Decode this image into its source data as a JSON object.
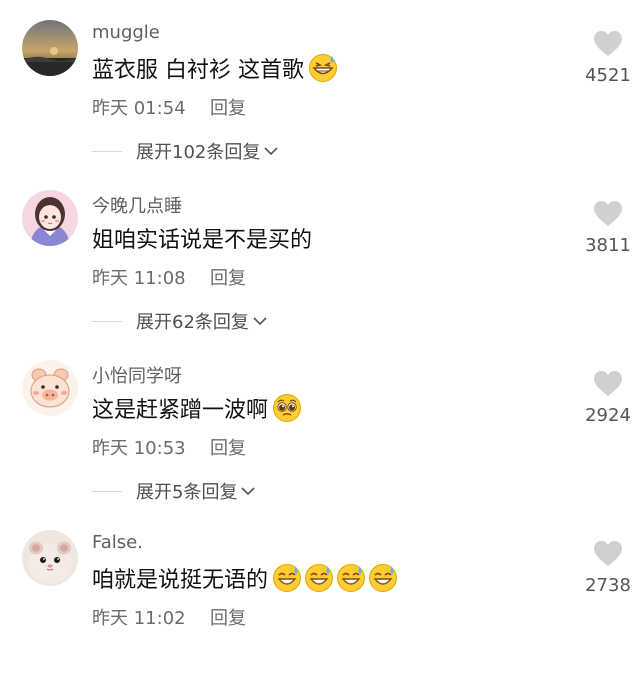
{
  "colors": {
    "text_primary": "#111111",
    "text_secondary": "#6b6b70",
    "heart": "#d0d0d3"
  },
  "comments": [
    {
      "username": "muggle",
      "text": "蓝衣服 白衬衫 这首歌",
      "emojis": [
        "grinning-sweat-emoji"
      ],
      "time": "昨天 01:54",
      "reply_label": "回复",
      "expand_label": "展开102条回复",
      "likes": "4521",
      "avatar": "sunset-landscape-avatar"
    },
    {
      "username": "今晚几点睡",
      "text": "姐咱实话说是不是买的",
      "emojis": [],
      "time": "昨天 11:08",
      "reply_label": "回复",
      "expand_label": "展开62条回复",
      "likes": "3811",
      "avatar": "cartoon-girl-avatar"
    },
    {
      "username": "小怡同学呀",
      "text": "这是赶紧蹭一波啊",
      "emojis": [
        "pleading-face-emoji"
      ],
      "time": "昨天 10:53",
      "reply_label": "回复",
      "expand_label": "展开5条回复",
      "likes": "2924",
      "avatar": "cartoon-pig-avatar"
    },
    {
      "username": "False.",
      "text": "咱就是说挺无语的",
      "emojis": [
        "sweat-smile-emoji",
        "sweat-smile-emoji",
        "sweat-smile-emoji",
        "sweat-smile-emoji"
      ],
      "time": "昨天 11:02",
      "reply_label": "回复",
      "expand_label": "",
      "likes": "2738",
      "avatar": "hamster-avatar"
    }
  ]
}
